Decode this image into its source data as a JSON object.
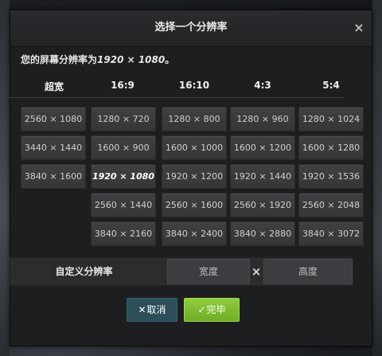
{
  "dialog": {
    "title": "选择一个分辨率",
    "close_icon": "×",
    "current_prefix": "您的屏幕分辨率为",
    "current_value": "1920 × 1080",
    "current_suffix": "。"
  },
  "columns": [
    "超宽",
    "16:9",
    "16:10",
    "4:3",
    "5:4"
  ],
  "resolutions": {
    "ultrawide": [
      "2560 × 1080",
      "3440 × 1440",
      "3840 × 1600"
    ],
    "r16_9": [
      "1280 × 720",
      "1600 × 900",
      "1920 × 1080",
      "2560 × 1440",
      "3840 × 2160"
    ],
    "r16_10": [
      "1280 × 800",
      "1600 × 1000",
      "1920 × 1200",
      "2560 × 1600",
      "3840 × 2400"
    ],
    "r4_3": [
      "1280 × 960",
      "1600 × 1200",
      "1920 × 1440",
      "2560 × 1920",
      "3840 × 2880"
    ],
    "r5_4": [
      "1280 × 1024",
      "1600 × 1280",
      "1920 × 1536",
      "2560 × 2048",
      "3840 × 3072"
    ]
  },
  "selected_resolution": "1920 × 1080",
  "custom": {
    "label": "自定义分辨率",
    "width_placeholder": "宽度",
    "separator": "×",
    "height_placeholder": "高度"
  },
  "buttons": {
    "cancel_icon": "✕",
    "cancel_label": "取消",
    "ok_icon": "✓",
    "ok_label": "完毕"
  },
  "colors": {
    "cancel_bg": "#2b4e58",
    "ok_bg": "#7fbf2f"
  }
}
